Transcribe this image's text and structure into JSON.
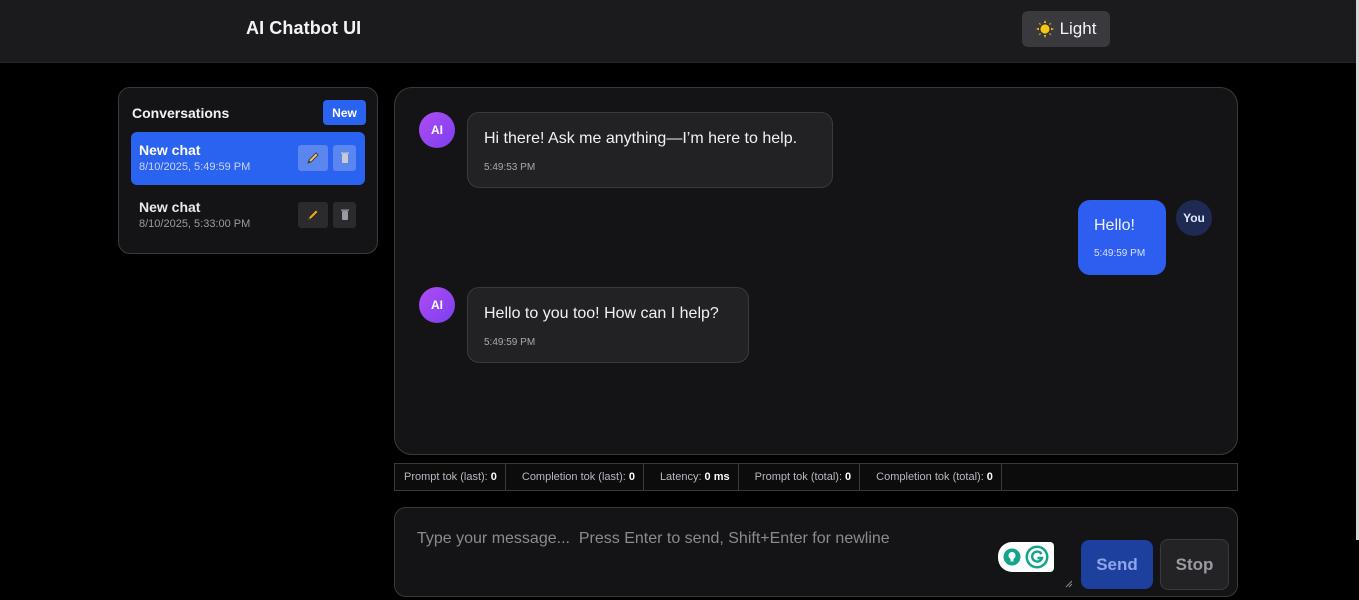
{
  "header": {
    "title": "AI Chatbot UI",
    "theme_toggle_label": "Light"
  },
  "sidebar": {
    "title": "Conversations",
    "new_button_label": "New",
    "conversations": [
      {
        "title": "New chat",
        "date": "8/10/2025, 5:49:59 PM",
        "active": true
      },
      {
        "title": "New chat",
        "date": "8/10/2025, 5:33:00 PM",
        "active": false
      }
    ]
  },
  "messages": [
    {
      "role": "ai",
      "avatar": "AI",
      "text": "Hi there! Ask me anything—I’m here to help.",
      "time": "5:49:53 PM"
    },
    {
      "role": "user",
      "avatar": "You",
      "text": "Hello!",
      "time": "5:49:59 PM"
    },
    {
      "role": "ai",
      "avatar": "AI",
      "text": "Hello to you too! How can I help?",
      "time": "5:49:59 PM"
    }
  ],
  "stats": [
    {
      "label": "Prompt tok (last):",
      "value": "0"
    },
    {
      "label": "Completion tok (last):",
      "value": "0"
    },
    {
      "label": "Latency:",
      "value": "0 ms"
    },
    {
      "label": "Prompt tok (total):",
      "value": "0"
    },
    {
      "label": "Completion tok (total):",
      "value": "0"
    }
  ],
  "composer": {
    "placeholder": "Type your message...  Press Enter to send, Shift+Enter for newline",
    "value": "",
    "send_label": "Send",
    "stop_label": "Stop"
  },
  "colors": {
    "accent": "#2a63f0",
    "background": "#000000",
    "panel": "#141416",
    "ai_avatar": "#9b45f1"
  }
}
